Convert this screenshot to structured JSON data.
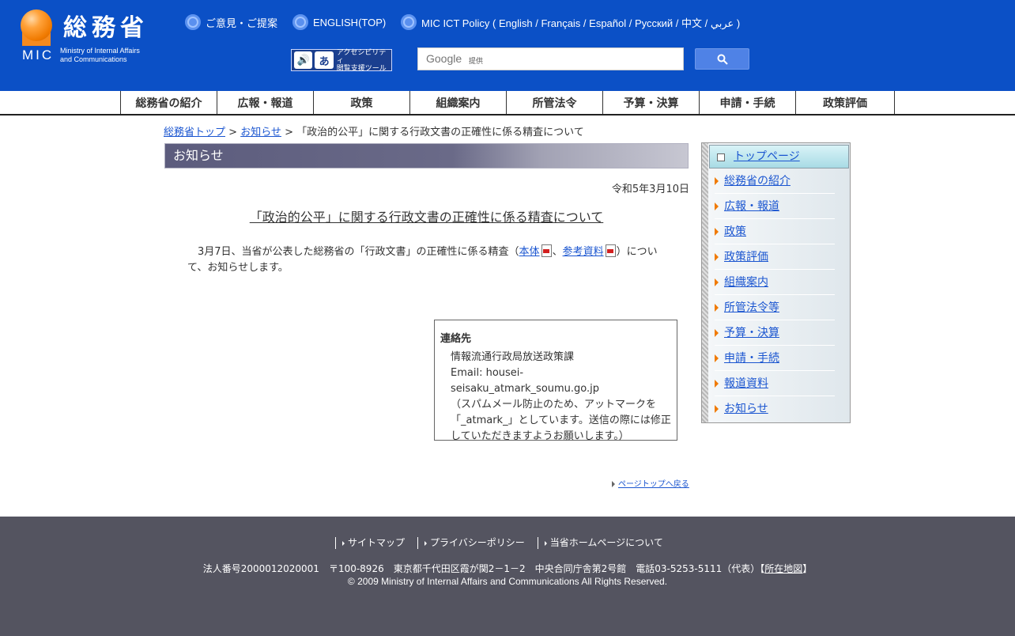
{
  "header": {
    "logo_kanji": "総務省",
    "logo_mic": "MIC",
    "logo_en_line1": "Ministry of Internal Affairs",
    "logo_en_line2": "and Communications",
    "links": [
      {
        "label": "ご意見・ご提案"
      },
      {
        "label": "ENGLISH(TOP)"
      },
      {
        "label": "MIC ICT Policy ( English / Français / Español / Русский / 中文 / عربي )"
      }
    ],
    "a11y_line1": "アクセシビリティ",
    "a11y_line2": "閲覧支援ツール",
    "search_brand": "Google",
    "search_provided": "提供"
  },
  "global_nav": [
    {
      "label": "総務省の紹介"
    },
    {
      "label": "広報・報道"
    },
    {
      "label": "政策"
    },
    {
      "label": "組織案内"
    },
    {
      "label": "所管法令"
    },
    {
      "label": "予算・決算"
    },
    {
      "label": "申請・手続"
    },
    {
      "label": "政策評価"
    }
  ],
  "breadcrumb": {
    "home": "総務省トップ",
    "sep": " > ",
    "section": "お知らせ",
    "current": "「政治的公平」に関する行政文書の正確性に係る精査について"
  },
  "main": {
    "section_title": "お知らせ",
    "date": "令和5年3月10日",
    "title": "「政治的公平」に関する行政文書の正確性に係る精査について",
    "body_prefix": "3月7日、当省が公表した総務省の「行政文書」の正確性に係る精査（",
    "link_main": "本体",
    "comma": "、",
    "link_ref": "参考資料",
    "body_suffix": "）について、お知らせします。"
  },
  "contact": {
    "heading": "連絡先",
    "dept": "情報流通行政局放送政策課",
    "email": "Email: housei-seisaku_atmark_soumu.go.jp",
    "note": "（スパムメール防止のため、アットマークを「_atmark_」としています。送信の際には修正していただきますようお願いします。）"
  },
  "pagetop": "ページトップへ戻る",
  "sidebar": {
    "top": "トップページ",
    "items": [
      {
        "label": "総務省の紹介"
      },
      {
        "label": "広報・報道"
      },
      {
        "label": "政策"
      },
      {
        "label": "政策評価"
      },
      {
        "label": "組織案内"
      },
      {
        "label": "所管法令等"
      },
      {
        "label": "予算・決算"
      },
      {
        "label": "申請・手続"
      },
      {
        "label": "報道資料"
      },
      {
        "label": "お知らせ"
      }
    ]
  },
  "footer": {
    "links": [
      {
        "label": "サイトマップ"
      },
      {
        "label": "プライバシーポリシー"
      },
      {
        "label": "当省ホームページについて"
      }
    ],
    "address": "法人番号2000012020001　〒100-8926　東京都千代田区霞が関2－1－2　中央合同庁舎第2号館　電話03-5253-5111（代表）",
    "map_open": "【",
    "map_link": "所在地図",
    "map_close": "】",
    "copyright": "© 2009 Ministry of Internal Affairs and Communications All Rights Reserved."
  },
  "colors": {
    "header_bg": "#0b50c6",
    "footer_bg": "#545460",
    "link": "#1a55d0",
    "accent_orange": "#f07a00"
  }
}
